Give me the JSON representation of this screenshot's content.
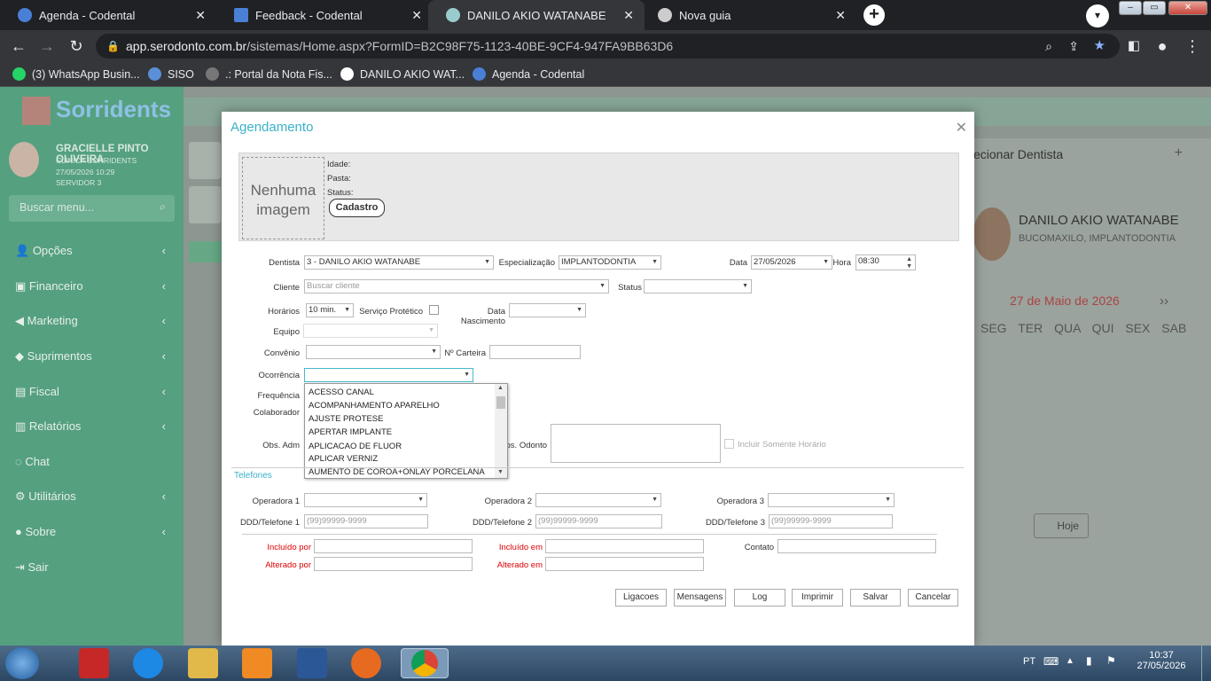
{
  "browser": {
    "tabs": [
      {
        "title": "Agenda - Codental",
        "active": false
      },
      {
        "title": "Feedback - Codental",
        "active": false
      },
      {
        "title": "DANILO AKIO WATANABE",
        "active": true
      },
      {
        "title": "Nova guia",
        "active": false
      }
    ],
    "url_host": "app.serodonto.com.br",
    "url_path": "/sistemas/Home.aspx?FormID=B2C98F75-1123-40BE-9CF4-947FA9BB63D6",
    "bookmarks": [
      "(3) WhatsApp Busin...",
      "SISO",
      ".: Portal da Nota Fis...",
      "DANILO AKIO WAT...",
      "Agenda - Codental"
    ]
  },
  "sidebar": {
    "user_name": "GRACIELLE PINTO OLIVEIRA",
    "clinic": "CLINICA SORRIDENTS",
    "datetime": "27/05/2026 10:29",
    "server": "SERVIDOR 3",
    "search_placeholder": "Buscar menu...",
    "menu": [
      "Opções",
      "Financeiro",
      "Marketing",
      "Suprimentos",
      "Fiscal",
      "Relatórios",
      "Chat",
      "Utilitários",
      "Sobre",
      "Sair"
    ]
  },
  "right_panel": {
    "select_dentist": "ecionar Dentista",
    "dentist_name": "DANILO AKIO WATANABE",
    "dentist_spec": "BUCOMAXILO, IMPLANTODONTIA",
    "month": "27 de Maio de 2026",
    "weekdays": [
      "SEG",
      "TER",
      "QUA",
      "QUI",
      "SEX",
      "SAB"
    ],
    "today_label": "Hoje"
  },
  "modal": {
    "title": "Agendamento",
    "no_image": "Nenhuma imagem",
    "idade_label": "Idade:",
    "pasta_label": "Pasta:",
    "status_label": "Status:",
    "cadastro_button": "Cadastro",
    "dentista_label": "Dentista",
    "dentista_value": "3 - DANILO AKIO WATANABE",
    "especializacao_label": "Especialização",
    "especializacao_value": "IMPLANTODONTIA",
    "data_label": "Data",
    "data_value": "27/05/2026",
    "hora_label": "Hora",
    "hora_value": "08:30",
    "cliente_label": "Cliente",
    "cliente_placeholder": "Buscar cliente",
    "status_field_label": "Status",
    "horarios_label": "Horários",
    "horarios_value": "10 min.",
    "servico_protetico_label": "Serviço Protético",
    "data_nascimento_label": "Data Nascimento",
    "equipo_label": "Equipo",
    "convenio_label": "Convênio",
    "carteira_label": "Nº Carteira",
    "ocorrencia_label": "Ocorrência",
    "frequencia_label": "Frequência",
    "colaborador_label": "Colaborador",
    "obs_adm_label": "Obs. Adm",
    "obs_odonto_label": "ps. Odonto",
    "incluir_horario_label": "Incluir Somente Horário",
    "telefones_label": "Telefones",
    "operadora1_label": "Operadora 1",
    "operadora2_label": "Operadora 2",
    "operadora3_label": "Operadora 3",
    "tel1_label": "DDD/Telefone 1",
    "tel2_label": "DDD/Telefone 2",
    "tel3_label": "DDD/Telefone 3",
    "tel_placeholder": "(99)99999-9999",
    "incluido_por_label": "Incluído por",
    "incluido_em_label": "Incluído em",
    "contato_label": "Contato",
    "alterado_por_label": "Alterado por",
    "alterado_em_label": "Alterado em",
    "buttons": [
      "Ligacoes",
      "Mensagens",
      "Log",
      "Imprimir",
      "Salvar",
      "Cancelar"
    ],
    "ocorrencia_options": [
      "ACESSO CANAL",
      "ACOMPANHAMENTO APARELHO",
      "AJUSTE PROTESE",
      "APERTAR IMPLANTE",
      "APLICACAO DE FLUOR",
      "APLICAR VERNIZ",
      "AUMENTO DE COROA+ONLAY PORCELANA"
    ]
  },
  "taskbar": {
    "lang": "PT",
    "time": "10:37",
    "date": "27/05/2026"
  }
}
